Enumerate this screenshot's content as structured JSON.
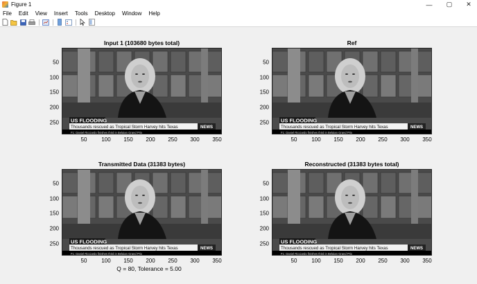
{
  "window": {
    "title": "Figure 1",
    "minimize_glyph": "—",
    "maximize_glyph": "▢",
    "close_glyph": "✕"
  },
  "menu": [
    "File",
    "Edit",
    "View",
    "Insert",
    "Tools",
    "Desktop",
    "Window",
    "Help"
  ],
  "toolbar": {
    "icons": [
      "new-figure-icon",
      "open-file-icon",
      "save-icon",
      "print-icon",
      "link-plot-icon",
      "insert-colorbar-icon",
      "insert-legend-icon",
      "pointer-icon",
      "property-inspector-icon"
    ]
  },
  "plots": [
    {
      "title": "Input  1 (103680 bytes total)",
      "yticks": [
        "50",
        "100",
        "150",
        "200",
        "250"
      ],
      "xticks": [
        "50",
        "100",
        "150",
        "200",
        "250",
        "300",
        "350"
      ]
    },
    {
      "title": "Ref",
      "yticks": [
        "50",
        "100",
        "150",
        "200",
        "250"
      ],
      "xticks": [
        "50",
        "100",
        "150",
        "200",
        "250",
        "300",
        "350"
      ]
    },
    {
      "title": "Transmitted Data (31383 bytes)",
      "yticks": [
        "50",
        "100",
        "150",
        "200",
        "250"
      ],
      "xticks": [
        "50",
        "100",
        "150",
        "200",
        "250",
        "300",
        "350"
      ]
    },
    {
      "title": "Reconstructed (31383 bytes total)",
      "yticks": [
        "50",
        "100",
        "150",
        "200",
        "250"
      ],
      "xticks": [
        "50",
        "100",
        "150",
        "200",
        "250",
        "300",
        "350"
      ]
    }
  ],
  "image_overlay": {
    "banner": "US FLOODING",
    "headline": "Thousands rescued as Tropical Storm Harvey hits Texas",
    "ticker": "F1: Daniel Ricciardo finishes third in Belgian Grand Prix",
    "logo": "NEWS"
  },
  "status": "Q = 80, Tolerance = 5.00"
}
